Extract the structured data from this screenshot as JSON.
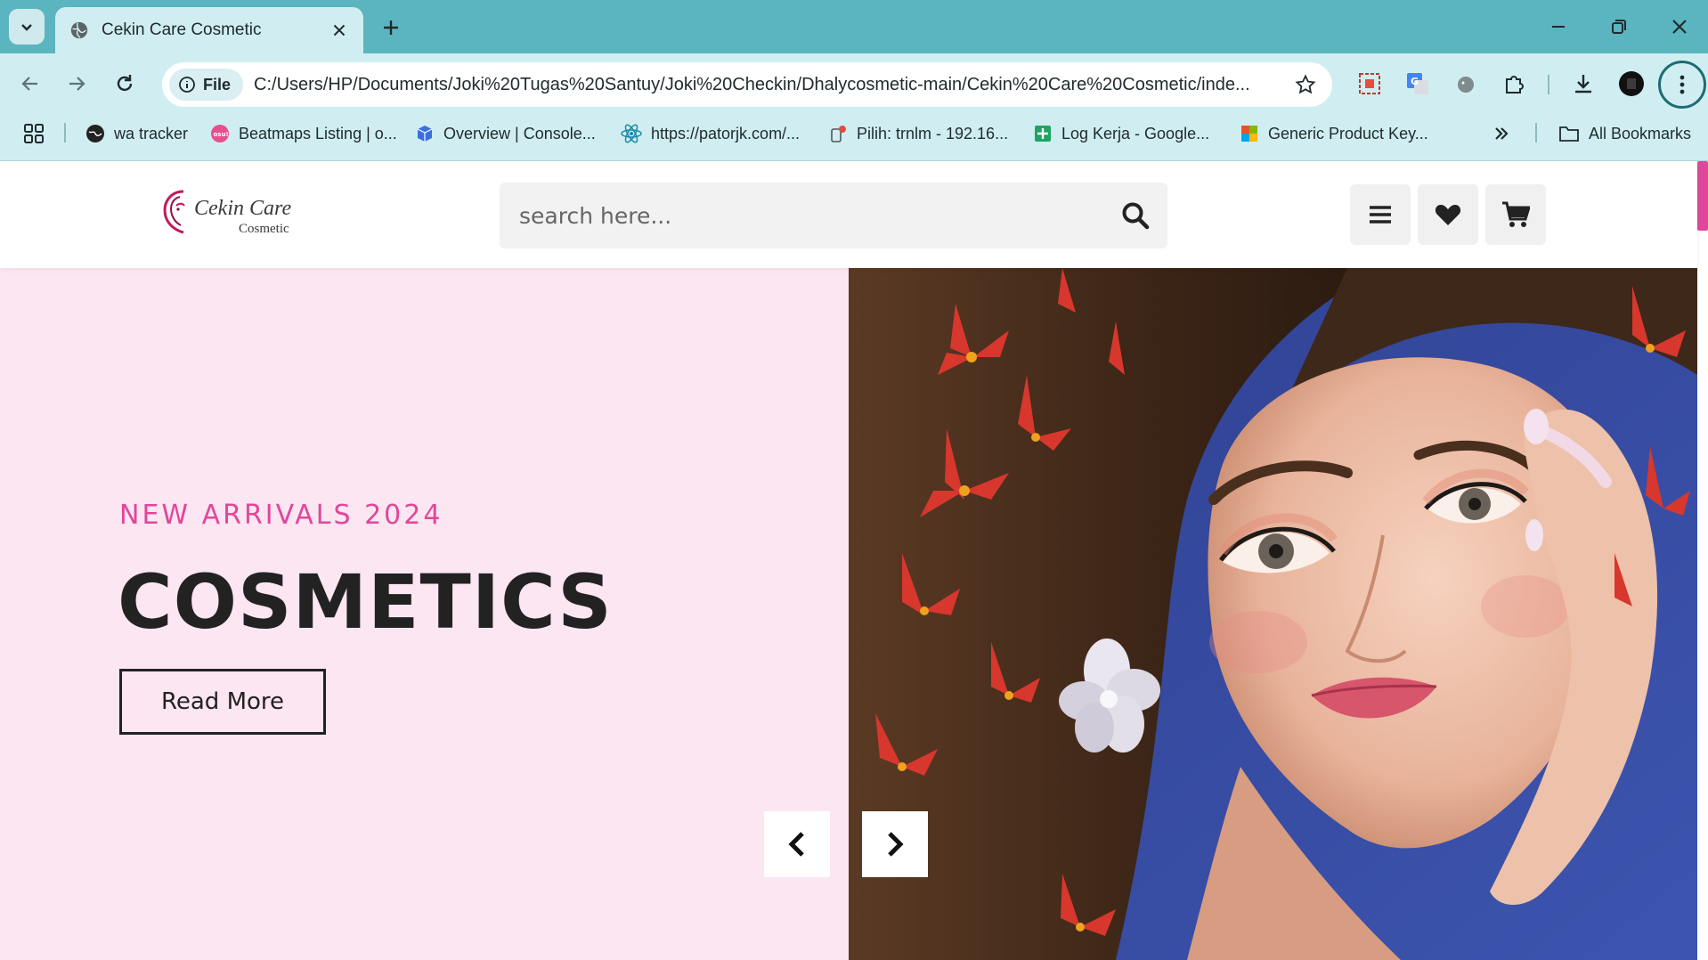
{
  "browser": {
    "tab_title": "Cekin Care Cosmetic",
    "url_chip": "File",
    "url": "C:/Users/HP/Documents/Joki%20Tugas%20Santuy/Joki%20Checkin/Dhalycosmetic-main/Cekin%20Care%20Cosmetic/inde...",
    "bookmarks": [
      {
        "label": "wa tracker",
        "icon": "globe-icon",
        "color": "#222222"
      },
      {
        "label": "Beatmaps Listing | o...",
        "icon": "osu-icon",
        "color": "#e6508f"
      },
      {
        "label": "Overview | Console...",
        "icon": "cube-icon",
        "color": "#3b6fe0"
      },
      {
        "label": "https://patorjk.com/...",
        "icon": "react-icon",
        "color": "#1c8aa8"
      },
      {
        "label": "Pilih: trnlm - 192.16...",
        "icon": "db-icon",
        "color": "#666666"
      },
      {
        "label": "Log Kerja - Google...",
        "icon": "sheets-icon",
        "color": "#1fa463"
      },
      {
        "label": "Generic Product Key...",
        "icon": "office-icon",
        "color": "#d83b01"
      }
    ],
    "all_bookmarks": "All Bookmarks"
  },
  "site": {
    "logo_brand": "Cekin Care",
    "logo_sub": "Cosmetic",
    "search_placeholder": "search here...",
    "accent": "#e0479b",
    "hero": {
      "subtitle": "NEW ARRIVALS 2024",
      "title": "COSMETICS",
      "button": "Read More",
      "background": "#fce6f1"
    }
  }
}
